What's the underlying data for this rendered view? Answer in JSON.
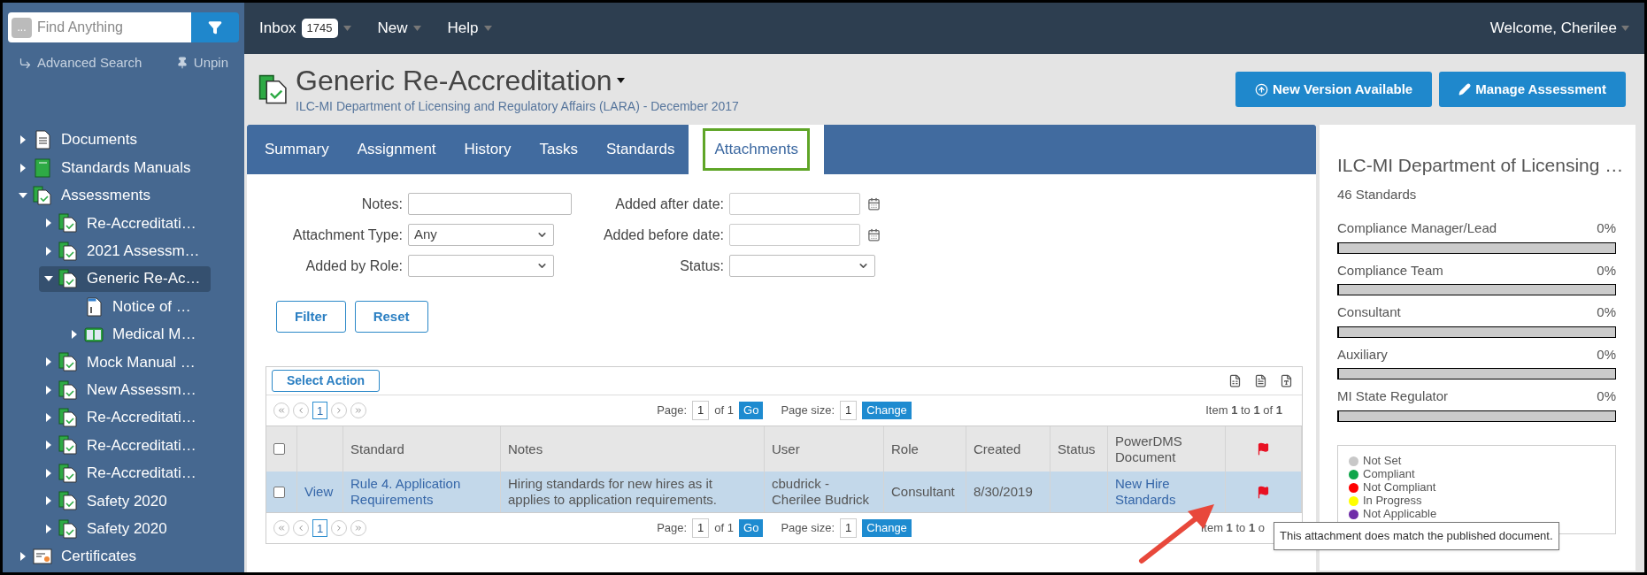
{
  "sidebar": {
    "search": {
      "placeholder": "Find Anything",
      "prefix": "..."
    },
    "links": [
      {
        "label": "Advanced Search",
        "kind": "search"
      },
      {
        "label": "Unpin",
        "kind": "pin"
      }
    ],
    "tree": [
      {
        "label": "Documents",
        "kind": "document",
        "expanded": false,
        "selected": false
      },
      {
        "label": "Standards Manuals",
        "kind": "manual",
        "expanded": false,
        "selected": false
      },
      {
        "label": "Assessments",
        "kind": "assessment",
        "expanded": true,
        "selected": false,
        "children": [
          {
            "label": "Re-Accreditati…",
            "kind": "assessment",
            "expanded": false,
            "selected": false
          },
          {
            "label": "2021 Assessm…",
            "kind": "assessment",
            "expanded": false,
            "selected": false
          },
          {
            "label": "Generic Re-Ac…",
            "kind": "assessment",
            "expanded": true,
            "selected": true,
            "children": [
              {
                "label": "Notice of …",
                "kind": "notice",
                "selected": false
              },
              {
                "label": "Medical M…",
                "kind": "medical",
                "expanded": false,
                "selected": false
              }
            ]
          },
          {
            "label": "Mock Manual …",
            "kind": "assessment",
            "expanded": false,
            "selected": false
          },
          {
            "label": "New Assessm…",
            "kind": "assessment",
            "expanded": false,
            "selected": false
          },
          {
            "label": "Re-Accreditati…",
            "kind": "assessment",
            "expanded": false,
            "selected": false
          },
          {
            "label": "Re-Accreditati…",
            "kind": "assessment",
            "expanded": false,
            "selected": false
          },
          {
            "label": "Re-Accreditati…",
            "kind": "assessment",
            "expanded": false,
            "selected": false
          },
          {
            "label": "Safety 2020",
            "kind": "assessment",
            "expanded": false,
            "selected": false
          },
          {
            "label": "Safety 2020",
            "kind": "assessment",
            "expanded": false,
            "selected": false
          }
        ]
      },
      {
        "label": "Certificates",
        "kind": "certificate",
        "expanded": false,
        "selected": false
      }
    ]
  },
  "topbar": {
    "menus": [
      {
        "label": "Inbox",
        "badge": "1745"
      },
      {
        "label": "New"
      },
      {
        "label": "Help"
      }
    ],
    "user": "Welcome, Cherilee"
  },
  "header": {
    "title": "Generic Re-Accreditation",
    "subtitle": "ILC-MI Department of Licensing and Regulatory Affairs (LARA) - December 2017",
    "buttons": [
      {
        "label": "New Version Available",
        "kind": "upload"
      },
      {
        "label": "Manage Assessment",
        "kind": "edit"
      }
    ]
  },
  "tabs": [
    {
      "label": "Summary",
      "selected": false
    },
    {
      "label": "Assignment",
      "selected": false
    },
    {
      "label": "History",
      "selected": false
    },
    {
      "label": "Tasks",
      "selected": false
    },
    {
      "label": "Standards",
      "selected": false
    },
    {
      "label": "Attachments",
      "selected": true
    }
  ],
  "filters": [
    [
      {
        "label": "Notes:",
        "kind": "text"
      },
      {
        "label": "Attachment Type:",
        "kind": "select",
        "value": "Any"
      },
      {
        "label": "Added by Role:",
        "kind": "select"
      }
    ],
    [
      {
        "label": "Added after date:",
        "kind": "date"
      },
      {
        "label": "Added before date:",
        "kind": "date"
      },
      {
        "label": "Status:",
        "kind": "select"
      }
    ]
  ],
  "filter_buttons": [
    "Filter",
    "Reset"
  ],
  "grid": {
    "action": "Select Action",
    "pagers": [
      {
        "page": "1",
        "page_label": "Page:",
        "page_value": "1",
        "of": "of 1",
        "go": "Go",
        "size_label": "Page size:",
        "size_value": "1",
        "change": "Change",
        "summary": "Item **1** to **1** of **1**"
      },
      {
        "page": "1",
        "page_label": "Page:",
        "page_value": "1",
        "of": "of 1",
        "go": "Go",
        "size_label": "Page size:",
        "size_value": "1",
        "change": "Change",
        "summary": "Item **1** to **1** o"
      }
    ],
    "select_all": {
      "checked": false
    },
    "columns": [
      "",
      "Standard",
      "Notes",
      "User",
      "Role",
      "Created",
      "Status",
      "PowerDMS Document"
    ],
    "rows": [
      {
        "selected": true,
        "checked": false,
        "link": "View",
        "standard": "Rule 4. Application Requirements",
        "notes": "Hiring standards for new hires as it applies to application requirements.",
        "user": "cbudrick - Cherilee Budrick",
        "role": "Consultant",
        "created": "8/30/2019",
        "status": "",
        "document": "New Hire Standards",
        "flagged": true
      }
    ]
  },
  "tooltip": "This attachment does match the published document.",
  "summary": {
    "title": "ILC-MI Department of Licensing …",
    "count": "46 Standards",
    "progress": [
      {
        "label": "Compliance Manager/Lead",
        "level": 0,
        "reading": "0%"
      },
      {
        "label": "Compliance Team",
        "level": 0,
        "reading": "0%"
      },
      {
        "label": "Consultant",
        "level": 0,
        "reading": "0%"
      },
      {
        "label": "Auxiliary",
        "level": 0,
        "reading": "0%"
      },
      {
        "label": "MI State Regulator",
        "level": 0,
        "reading": "0%"
      }
    ],
    "legend": [
      {
        "label": "Not Set",
        "color": "#c8c8c8"
      },
      {
        "label": "Compliant",
        "color": "#10a64a"
      },
      {
        "label": "Not Compliant",
        "color": "#ff0000"
      },
      {
        "label": "In Progress",
        "color": "#ffff00"
      },
      {
        "label": "Not Applicable",
        "color": "#6f2da8"
      }
    ]
  }
}
